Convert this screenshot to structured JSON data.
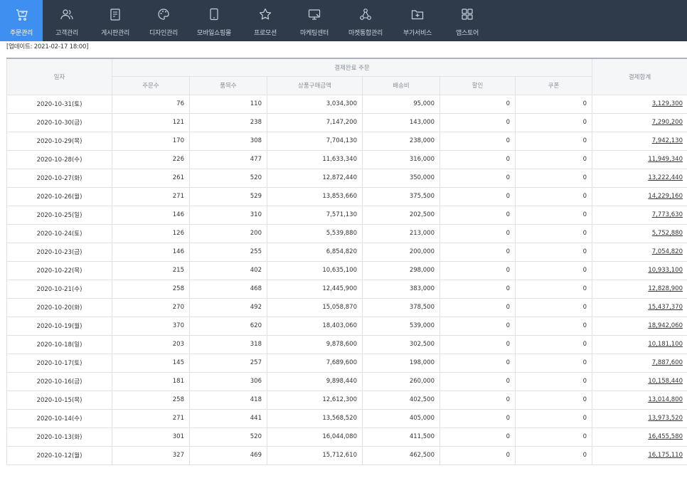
{
  "nav": [
    {
      "label": "주문관리",
      "icon": "cart-icon",
      "active": true
    },
    {
      "label": "고객관리",
      "icon": "customers-icon",
      "active": false
    },
    {
      "label": "게시판관리",
      "icon": "board-icon",
      "active": false
    },
    {
      "label": "디자인관리",
      "icon": "palette-icon",
      "active": false
    },
    {
      "label": "모바일쇼핑몰",
      "icon": "mobile-icon",
      "active": false
    },
    {
      "label": "프로모션",
      "icon": "star-icon",
      "active": false
    },
    {
      "label": "마케팅센터",
      "icon": "monitor-icon",
      "active": false
    },
    {
      "label": "마켓통합관리",
      "icon": "network-icon",
      "active": false
    },
    {
      "label": "부가서비스",
      "icon": "plus-folder-icon",
      "active": false
    },
    {
      "label": "앱스토어",
      "icon": "apps-grid-icon",
      "active": false
    }
  ],
  "update_text": "[업데이트: 2021-02-17 18:00]",
  "table": {
    "header": {
      "date": "일자",
      "group": "결제완료 주문",
      "cols": [
        "주문수",
        "품목수",
        "상품구매금액",
        "배송비",
        "할인",
        "쿠폰"
      ],
      "total": "결제합계"
    },
    "rows": [
      [
        "2020-10-31(토)",
        "76",
        "110",
        "3,034,300",
        "95,000",
        "0",
        "0",
        "3,129,300"
      ],
      [
        "2020-10-30(금)",
        "121",
        "238",
        "7,147,200",
        "143,000",
        "0",
        "0",
        "7,290,200"
      ],
      [
        "2020-10-29(목)",
        "170",
        "308",
        "7,704,130",
        "238,000",
        "0",
        "0",
        "7,942,130"
      ],
      [
        "2020-10-28(수)",
        "226",
        "477",
        "11,633,340",
        "316,000",
        "0",
        "0",
        "11,949,340"
      ],
      [
        "2020-10-27(화)",
        "261",
        "520",
        "12,872,440",
        "350,000",
        "0",
        "0",
        "13,222,440"
      ],
      [
        "2020-10-26(월)",
        "271",
        "529",
        "13,853,660",
        "375,500",
        "0",
        "0",
        "14,229,160"
      ],
      [
        "2020-10-25(일)",
        "146",
        "310",
        "7,571,130",
        "202,500",
        "0",
        "0",
        "7,773,630"
      ],
      [
        "2020-10-24(토)",
        "126",
        "200",
        "5,539,880",
        "213,000",
        "0",
        "0",
        "5,752,880"
      ],
      [
        "2020-10-23(금)",
        "146",
        "255",
        "6,854,820",
        "200,000",
        "0",
        "0",
        "7,054,820"
      ],
      [
        "2020-10-22(목)",
        "215",
        "402",
        "10,635,100",
        "298,000",
        "0",
        "0",
        "10,933,100"
      ],
      [
        "2020-10-21(수)",
        "258",
        "468",
        "12,445,900",
        "383,000",
        "0",
        "0",
        "12,828,900"
      ],
      [
        "2020-10-20(화)",
        "270",
        "492",
        "15,058,870",
        "378,500",
        "0",
        "0",
        "15,437,370"
      ],
      [
        "2020-10-19(월)",
        "370",
        "620",
        "18,403,060",
        "539,000",
        "0",
        "0",
        "18,942,060"
      ],
      [
        "2020-10-18(일)",
        "203",
        "318",
        "9,878,600",
        "302,500",
        "0",
        "0",
        "10,181,100"
      ],
      [
        "2020-10-17(토)",
        "145",
        "257",
        "7,689,600",
        "198,000",
        "0",
        "0",
        "7,887,600"
      ],
      [
        "2020-10-16(금)",
        "181",
        "306",
        "9,898,440",
        "260,000",
        "0",
        "0",
        "10,158,440"
      ],
      [
        "2020-10-15(목)",
        "258",
        "418",
        "12,612,300",
        "402,500",
        "0",
        "0",
        "13,014,800"
      ],
      [
        "2020-10-14(수)",
        "271",
        "441",
        "13,568,520",
        "405,000",
        "0",
        "0",
        "13,973,520"
      ],
      [
        "2020-10-13(화)",
        "301",
        "520",
        "16,044,080",
        "411,500",
        "0",
        "0",
        "16,455,580"
      ],
      [
        "2020-10-12(월)",
        "327",
        "469",
        "15,712,610",
        "462,500",
        "0",
        "0",
        "16,175,110"
      ]
    ]
  }
}
